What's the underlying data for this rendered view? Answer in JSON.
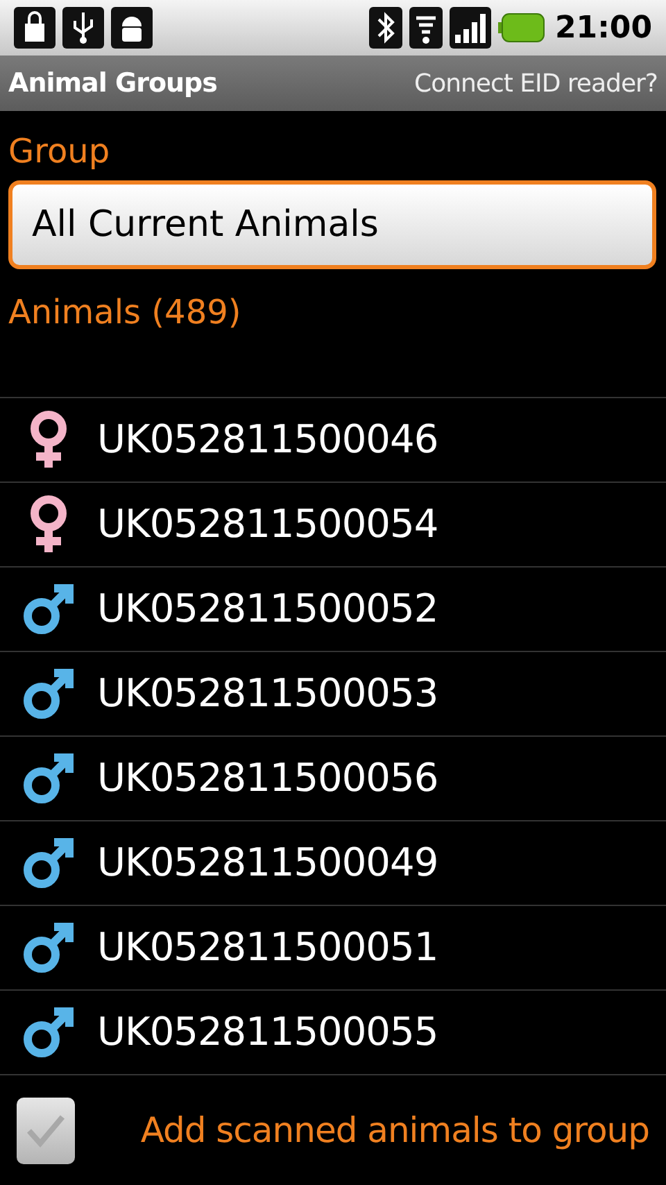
{
  "status_bar": {
    "time": "21:00"
  },
  "title_bar": {
    "title": "Animal Groups",
    "action": "Connect EID reader?"
  },
  "group": {
    "label": "Group",
    "value": "All Current Animals"
  },
  "animals": {
    "header": "Animals (489)",
    "rows": [
      {
        "tag": "UK052811500046",
        "kind": "female"
      },
      {
        "tag": "UK052811500054",
        "kind": "female"
      },
      {
        "tag": "UK052811500052",
        "kind": "male"
      },
      {
        "tag": "UK052811500053",
        "kind": "male"
      },
      {
        "tag": "UK052811500056",
        "kind": "male"
      },
      {
        "tag": "UK052811500049",
        "kind": "male"
      },
      {
        "tag": "UK052811500051",
        "kind": "male"
      },
      {
        "tag": "UK052811500055",
        "kind": "male"
      }
    ]
  },
  "add_scanned": {
    "label": "Add scanned animals to group",
    "checked": false
  }
}
